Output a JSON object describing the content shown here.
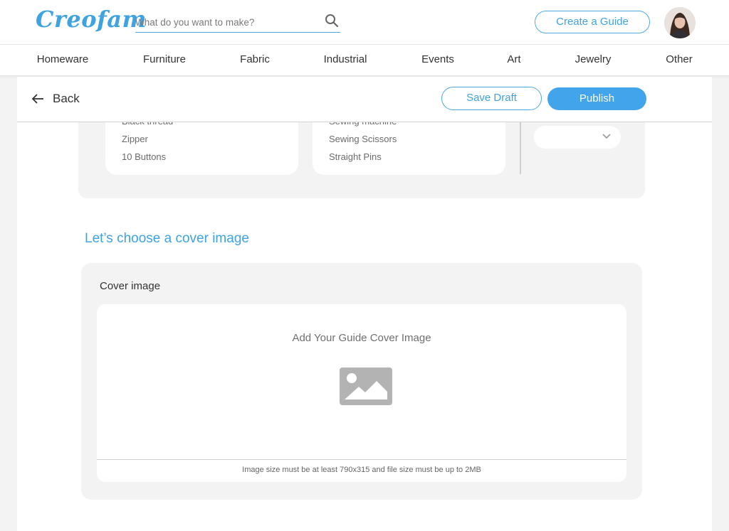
{
  "header": {
    "logo": "Creofam",
    "search": {
      "placeholder": "What do you want to make?",
      "icon": "search-icon"
    },
    "create_guide_label": "Create a Guide",
    "avatar_icon": "user-avatar"
  },
  "categories": [
    "Homeware",
    "Furniture",
    "Fabric",
    "Industrial",
    "Events",
    "Art",
    "Jewelry",
    "Other"
  ],
  "action_bar": {
    "back_label": "Back",
    "save_draft_label": "Save Draft",
    "publish_label": "Publish"
  },
  "materials": [
    "Black thread",
    "Zipper",
    "10 Buttons"
  ],
  "tools": [
    "Sewing machine",
    "Sewing Scissors",
    "Straight Pins"
  ],
  "cover": {
    "section_title": "Let’s choose a cover image",
    "card_label": "Cover image",
    "dropzone_title": "Add Your Guide Cover Image",
    "dropzone_icon": "image-placeholder-icon",
    "size_note": "Image size must be at least 790x315 and file size must be up to 2MB"
  },
  "colors": {
    "accent": "#42a5ec",
    "accent_text": "#3ea3e0",
    "page_bg": "#f3f3f3"
  }
}
